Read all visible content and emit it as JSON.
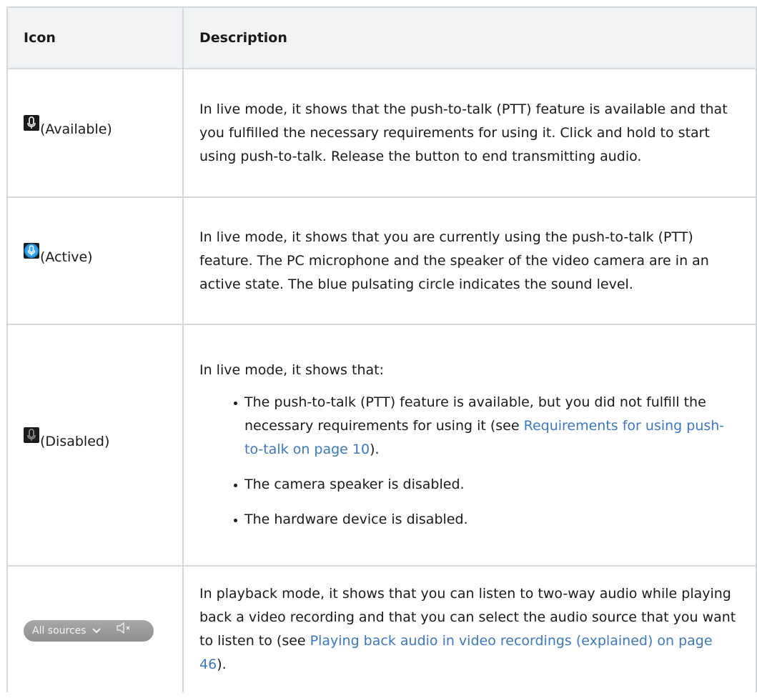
{
  "table": {
    "header": {
      "icon": "Icon",
      "description": "Description"
    },
    "rows": {
      "available": {
        "icon_name": "microphone-available-icon",
        "label": "(Available)",
        "description": "In live mode, it shows that the push-to-talk (PTT) feature is available and that you fulfilled the necessary requirements for using it. Click and hold to start using push-to-talk. Release the button to end transmitting audio."
      },
      "active": {
        "icon_name": "microphone-active-icon",
        "label": "(Active)",
        "description": "In live mode, it shows that you are currently using the push-to-talk (PTT) feature. The PC microphone and the speaker of the video camera are in an active state. The blue pulsating circle indicates the sound level."
      },
      "disabled": {
        "icon_name": "microphone-disabled-icon",
        "label": "(Disabled)",
        "intro": "In live mode, it shows that:",
        "bullet1_before": "The push-to-talk (PTT) feature is available, but you did not fulfill the necessary requirements for using it (see ",
        "bullet1_link": "Requirements for using push-to-talk on page 10",
        "bullet1_after": ").",
        "bullet2": "The camera speaker is disabled.",
        "bullet3": "The hardware device is disabled."
      },
      "playback": {
        "pill_label": "All sources",
        "pill_icons": [
          "chevron-down-icon",
          "speaker-muted-icon"
        ],
        "description_before": "In playback mode, it shows that you can listen to two-way audio while playing back a video recording and that you can select the audio source that you want to listen to (see ",
        "description_link": "Playing back audio in video recordings (explained) on page 46",
        "description_after": ")."
      }
    }
  },
  "colors": {
    "header_bg": "#f1f2f3",
    "border": "#d6d9dc",
    "link": "#3a78c2",
    "icon_active": "#1e8ee0",
    "icon_dark": "#1b1b1b",
    "pill_bg": "#9b9b9b"
  }
}
